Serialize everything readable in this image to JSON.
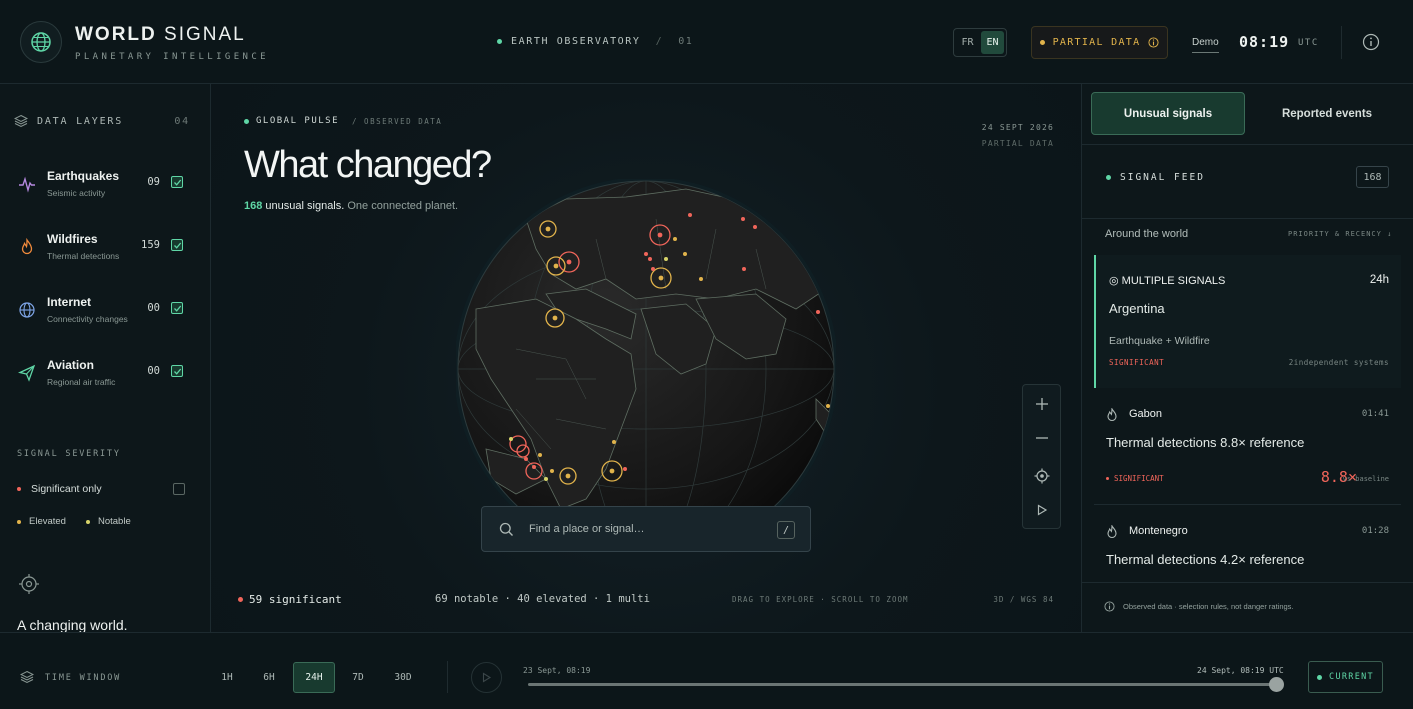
{
  "colors": {
    "accent": "#5fd6a6",
    "significant": "#f0655a",
    "elevated": "#e1b34b",
    "notable": "#d7d46a",
    "background": "#0c1519"
  },
  "header": {
    "brand_bold": "WORLD",
    "brand_light": "SIGNAL",
    "tagline": "PLANETARY INTELLIGENCE",
    "observatory": "EARTH OBSERVATORY",
    "observatory_sep": "/",
    "observatory_num": "01",
    "lang_fr": "FR",
    "lang_en": "EN",
    "partial_data": "PARTIAL DATA",
    "demo": "Demo",
    "time": "08:19",
    "tz": "UTC",
    "icons": {
      "brand": "globe-icon",
      "info": "info-icon"
    }
  },
  "sidebar": {
    "title": "DATA LAYERS",
    "count": "04",
    "layers": [
      {
        "title": "Earthquakes",
        "sub": "Seismic activity",
        "value": "09",
        "icon": "seismic-icon"
      },
      {
        "title": "Wildfires",
        "sub": "Thermal detections",
        "value": "159",
        "icon": "flame-icon"
      },
      {
        "title": "Internet",
        "sub": "Connectivity changes",
        "value": "00",
        "icon": "globe-icon"
      },
      {
        "title": "Aviation",
        "sub": "Regional air traffic",
        "value": "00",
        "icon": "plane-icon"
      }
    ],
    "severity_title": "SIGNAL SEVERITY",
    "significant_only": "Significant only",
    "elevated": "Elevated",
    "notable": "Notable",
    "tagline": "A changing world."
  },
  "center": {
    "pulse": "GLOBAL PULSE",
    "observed": "/ OBSERVED DATA",
    "date": "24 SEPT 2026",
    "partial": "PARTIAL DATA",
    "headline": "What changed?",
    "count": "168",
    "sub1": "unusual signals.",
    "sub2": "One connected planet.",
    "search_placeholder": "Find a place or signal…",
    "search_key": "/",
    "significant": "59 significant",
    "rest": "69 notable · 40 elevated · 1 multi",
    "hint": "DRAG TO EXPLORE  ·  SCROLL TO ZOOM",
    "projection": "3D / WGS 84"
  },
  "panel": {
    "tab_unusual": "Unusual signals",
    "tab_reported": "Reported events",
    "feed_title": "SIGNAL FEED",
    "feed_count": "168",
    "around": "Around the world",
    "priority": "PRIORITY & RECENCY ↓",
    "cards": [
      {
        "label": "◎ MULTIPLE SIGNALS",
        "time": "24h",
        "place": "Argentina",
        "kinds": "Earthquake + Wildfire",
        "severity": "SIGNIFICANT",
        "systems": "2independent systems"
      },
      {
        "name": "Gabon",
        "time": "01:41",
        "desc": "Thermal detections 8.8× reference",
        "severity": "SIGNIFICANT",
        "ratio": "8.8×",
        "baseline": "vs baseline"
      },
      {
        "name": "Montenegro",
        "time": "01:28",
        "desc": "Thermal detections 4.2× reference"
      }
    ],
    "footnote": "Observed data · selection rules, not danger ratings."
  },
  "timeline": {
    "title": "TIME WINDOW",
    "ranges": [
      "1H",
      "6H",
      "24H",
      "7D",
      "30D"
    ],
    "active": "24H",
    "start": "23 Sept, 08:19",
    "end": "24 Sept, 08:19 UTC",
    "current": "CURRENT"
  }
}
